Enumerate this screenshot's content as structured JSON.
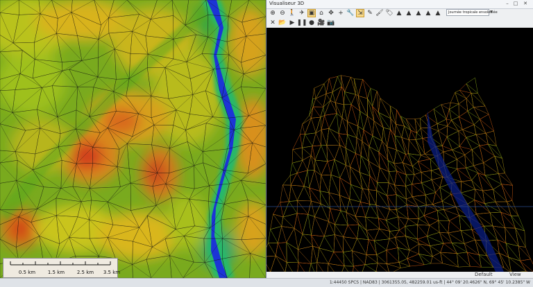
{
  "map": {
    "scale_labels": [
      "0.5 km",
      "1.5 km",
      "2.5 km",
      "3.5 km"
    ]
  },
  "viewer": {
    "title": "Visualiseur 3D",
    "window_controls": [
      "–",
      "□",
      "✕"
    ],
    "combo_value": "Journée tropicale ensoleillée",
    "combo_arrow": "▾",
    "toolbar1": [
      {
        "icon": "zoom-in-icon",
        "glyph": "⊕"
      },
      {
        "icon": "zoom-out-icon",
        "glyph": "⊖"
      },
      {
        "icon": "walk-icon",
        "glyph": "🚶"
      },
      {
        "icon": "fly-icon",
        "glyph": "✈"
      },
      {
        "icon": "frame-icon",
        "glyph": "▣"
      },
      {
        "icon": "home-icon",
        "glyph": "⌂"
      },
      {
        "icon": "center-icon",
        "glyph": "✥"
      },
      {
        "icon": "crosshair-icon",
        "glyph": "+"
      },
      {
        "icon": "tool-icon",
        "glyph": "🔧"
      },
      {
        "icon": "select-icon",
        "glyph": "⇲"
      },
      {
        "icon": "pencil-icon",
        "glyph": "✎"
      },
      {
        "icon": "brush-icon",
        "glyph": "🖌"
      },
      {
        "icon": "tag-icon",
        "glyph": "🏷"
      },
      {
        "icon": "terrain-up-icon",
        "glyph": "▲"
      },
      {
        "icon": "terrain-down-icon",
        "glyph": "▲"
      },
      {
        "icon": "terrain-left-icon",
        "glyph": "▲"
      },
      {
        "icon": "terrain-right-icon",
        "glyph": "▲"
      },
      {
        "icon": "terrain-reset-icon",
        "glyph": "▲"
      }
    ],
    "toolbar2": [
      {
        "icon": "close-tool-icon",
        "glyph": "✕"
      },
      {
        "icon": "open-tool-icon",
        "glyph": "📂"
      },
      {
        "icon": "play-icon",
        "glyph": "▶"
      },
      {
        "icon": "pause-icon",
        "glyph": "❚❚"
      },
      {
        "icon": "record-icon",
        "glyph": "●"
      },
      {
        "icon": "camera-video-icon",
        "glyph": "🎥"
      },
      {
        "icon": "camera-icon",
        "glyph": "📷"
      }
    ],
    "status_default": "Default",
    "status_view": "View"
  },
  "statusbar": {
    "text": "1:44450   SPCS | NAD83 | 3061355.05, 482259.01 us-ft | 44° 09' 20.4626\" N, 69° 45' 10.2385\" W"
  },
  "colors": {
    "active": "#f8d98a",
    "viewer_bg": "#eef0f2",
    "render_bg": "#000000"
  }
}
